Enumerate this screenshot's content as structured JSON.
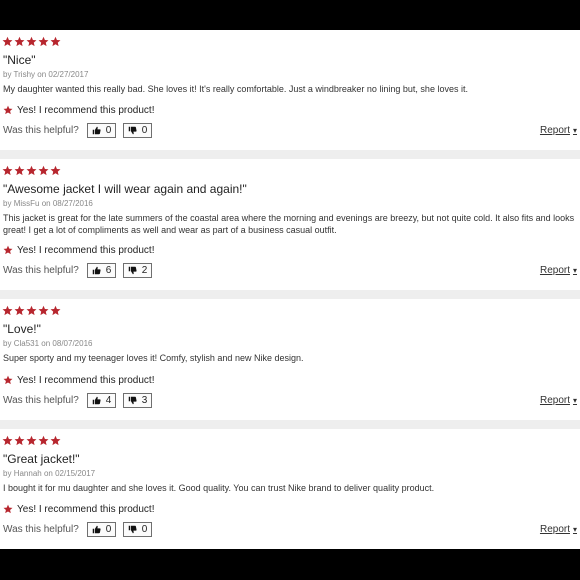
{
  "colors": {
    "star": "#b7262e",
    "separator": "#eeeeee",
    "frame": "#000000"
  },
  "labels": {
    "by": "by",
    "on": "on",
    "helpful": "Was this helpful?",
    "report": "Report",
    "recommend": "Yes! I recommend this product!"
  },
  "reviews": [
    {
      "rating": 5,
      "title": "\"Nice\"",
      "author": "Trishy",
      "date": "02/27/2017",
      "body": "My daughter wanted this really bad. She loves it! It's really comfortable. Just a windbreaker no lining but, she loves it.",
      "helpful_yes": "0",
      "helpful_no": "0"
    },
    {
      "rating": 5,
      "title": "\"Awesome jacket I will wear again and again!\"",
      "author": "MissFu",
      "date": "08/27/2016",
      "body": "This jacket is great for the late summers of the coastal area where the morning and evenings are breezy, but not quite cold. It also fits and looks great! I get a lot of compliments as well and wear as part of a business casual outfit.",
      "helpful_yes": "6",
      "helpful_no": "2"
    },
    {
      "rating": 5,
      "title": "\"Love!\"",
      "author": "Cla531",
      "date": "08/07/2016",
      "body": "Super sporty and my teenager loves it! Comfy, stylish and new Nike design.",
      "helpful_yes": "4",
      "helpful_no": "3"
    },
    {
      "rating": 5,
      "title": "\"Great jacket!\"",
      "author": "Hannah",
      "date": "02/15/2017",
      "body": "I bought it for mu daughter and she loves it. Good quality. You can trust Nike brand to deliver quality product.",
      "helpful_yes": "0",
      "helpful_no": "0"
    }
  ]
}
